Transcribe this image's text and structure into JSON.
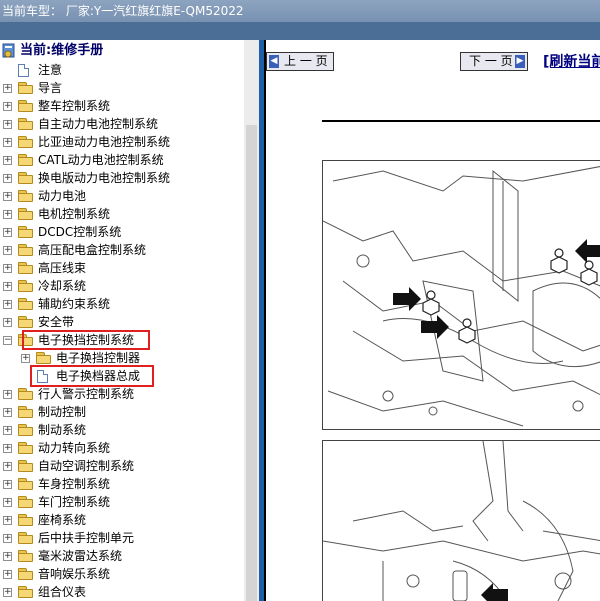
{
  "window": {
    "title": "当前车型： 厂家:Y一汽红旗红旗E-QM52022"
  },
  "tree": {
    "root": "当前:维修手册",
    "items": [
      {
        "label": "注意",
        "type": "doc"
      },
      {
        "label": "导言",
        "type": "folder"
      },
      {
        "label": "整车控制系统",
        "type": "folder"
      },
      {
        "label": "自主动力电池控制系统",
        "type": "folder"
      },
      {
        "label": "比亚迪动力电池控制系统",
        "type": "folder"
      },
      {
        "label": "CATL动力电池控制系统",
        "type": "folder"
      },
      {
        "label": "换电版动力电池控制系统",
        "type": "folder"
      },
      {
        "label": "动力电池",
        "type": "folder"
      },
      {
        "label": "电机控制系统",
        "type": "folder"
      },
      {
        "label": "DCDC控制系统",
        "type": "folder"
      },
      {
        "label": "高压配电盒控制系统",
        "type": "folder"
      },
      {
        "label": "高压线束",
        "type": "folder"
      },
      {
        "label": "冷却系统",
        "type": "folder"
      },
      {
        "label": "辅助约束系统",
        "type": "folder"
      },
      {
        "label": "安全带",
        "type": "folder"
      },
      {
        "label": "电子换挡控制系统",
        "type": "folder",
        "expanded": true
      },
      {
        "label": "电子换挡控制器",
        "type": "folder",
        "level": 2
      },
      {
        "label": "电子换档器总成",
        "type": "doc",
        "level": 2,
        "selected": true
      },
      {
        "label": "行人警示控制系统",
        "type": "folder"
      },
      {
        "label": "制动控制",
        "type": "folder"
      },
      {
        "label": "制动系统",
        "type": "folder"
      },
      {
        "label": "动力转向系统",
        "type": "folder"
      },
      {
        "label": "自动空调控制系统",
        "type": "folder"
      },
      {
        "label": "车身控制系统",
        "type": "folder"
      },
      {
        "label": "车门控制系统",
        "type": "folder"
      },
      {
        "label": "座椅系统",
        "type": "folder"
      },
      {
        "label": "后中扶手控制单元",
        "type": "folder"
      },
      {
        "label": "毫米波雷达系统",
        "type": "folder"
      },
      {
        "label": "音响娱乐系统",
        "type": "folder"
      },
      {
        "label": "组合仪表",
        "type": "folder"
      }
    ]
  },
  "content": {
    "prev_label": "上 一 页",
    "next_label": "下 一 页",
    "refresh_label": "[刷新当前"
  }
}
